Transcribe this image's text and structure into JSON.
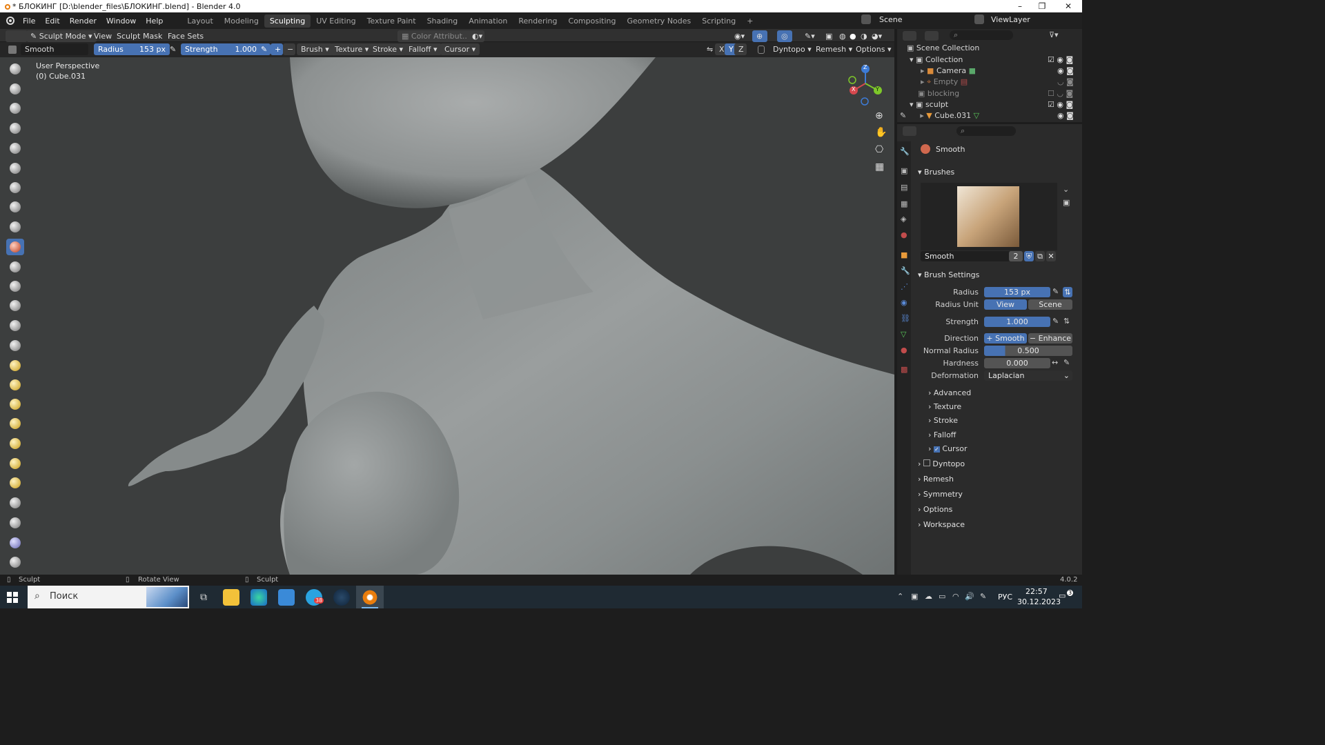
{
  "window": {
    "title": "* БЛОКИНГ [D:\\blender_files\\БЛОКИНГ.blend] - Blender 4.0",
    "min": "–",
    "max": "❐",
    "close": "✕"
  },
  "menubar": {
    "menus": [
      "File",
      "Edit",
      "Render",
      "Window",
      "Help"
    ],
    "workspaces": [
      "Layout",
      "Modeling",
      "Sculpting",
      "UV Editing",
      "Texture Paint",
      "Shading",
      "Animation",
      "Rendering",
      "Compositing",
      "Geometry Nodes",
      "Scripting"
    ],
    "active_workspace": "Sculpting",
    "add_tab": "+",
    "scene": "Scene",
    "view_layer": "ViewLayer"
  },
  "header1": {
    "mode": "Sculpt Mode",
    "menus": [
      "View",
      "Sculpt",
      "Mask",
      "Face Sets"
    ],
    "color_attribute": "Color Attribut..."
  },
  "header2": {
    "brush_name": "Smooth",
    "radius_label": "Radius",
    "radius_value": "153 px",
    "strength_label": "Strength",
    "strength_value": "1.000",
    "plus": "+",
    "minus": "−",
    "dropdowns": [
      "Brush",
      "Texture",
      "Stroke",
      "Falloff",
      "Cursor"
    ],
    "axes": [
      "X",
      "Y",
      "Z"
    ],
    "dyntopo": "Dyntopo",
    "remesh": "Remesh",
    "options": "Options"
  },
  "viewport": {
    "perspective": "User Perspective",
    "object": "(0) Cube.031",
    "gizmo": {
      "z": "Z",
      "x": "X",
      "y": "Y"
    }
  },
  "outliner": {
    "root": "Scene Collection",
    "items": [
      {
        "label": "Collection",
        "depth": 1
      },
      {
        "label": "Camera",
        "depth": 2
      },
      {
        "label": "Empty",
        "depth": 2
      },
      {
        "label": "blocking",
        "depth": 1
      },
      {
        "label": "sculpt",
        "depth": 1
      },
      {
        "label": "Cube.031",
        "depth": 2
      }
    ]
  },
  "properties": {
    "tool_name": "Smooth",
    "brushes_header": "Brushes",
    "brush_name": "Smooth",
    "brush_users": "2",
    "brush_settings_header": "Brush Settings",
    "radius_label": "Radius",
    "radius_value": "153 px",
    "radius_unit_label": "Radius Unit",
    "radius_unit_view": "View",
    "radius_unit_scene": "Scene",
    "strength_label": "Strength",
    "strength_value": "1.000",
    "direction_label": "Direction",
    "direction_smooth": "+ Smooth",
    "direction_enhance": "− Enhance ...",
    "normal_radius_label": "Normal Radius",
    "normal_radius_value": "0.500",
    "hardness_label": "Hardness",
    "hardness_value": "0.000",
    "deformation_label": "Deformation",
    "deformation_value": "Laplacian",
    "subsections": [
      "Advanced",
      "Texture",
      "Stroke",
      "Falloff",
      "Cursor"
    ],
    "sections": [
      "Dyntopo",
      "Remesh",
      "Symmetry",
      "Options",
      "Workspace"
    ]
  },
  "statusbar": {
    "left": "Sculpt",
    "middle": "Rotate View",
    "right_action": "Sculpt",
    "version": "4.0.2"
  },
  "taskbar": {
    "search_placeholder": "Поиск",
    "lang": "РУС",
    "time": "22:57",
    "date": "30.12.2023",
    "telegram_badge": "38",
    "notif_badge": "3"
  },
  "colors": {
    "accent": "#4772b3",
    "header_bg": "#303030",
    "viewport_bg": "#3c3e3e"
  }
}
